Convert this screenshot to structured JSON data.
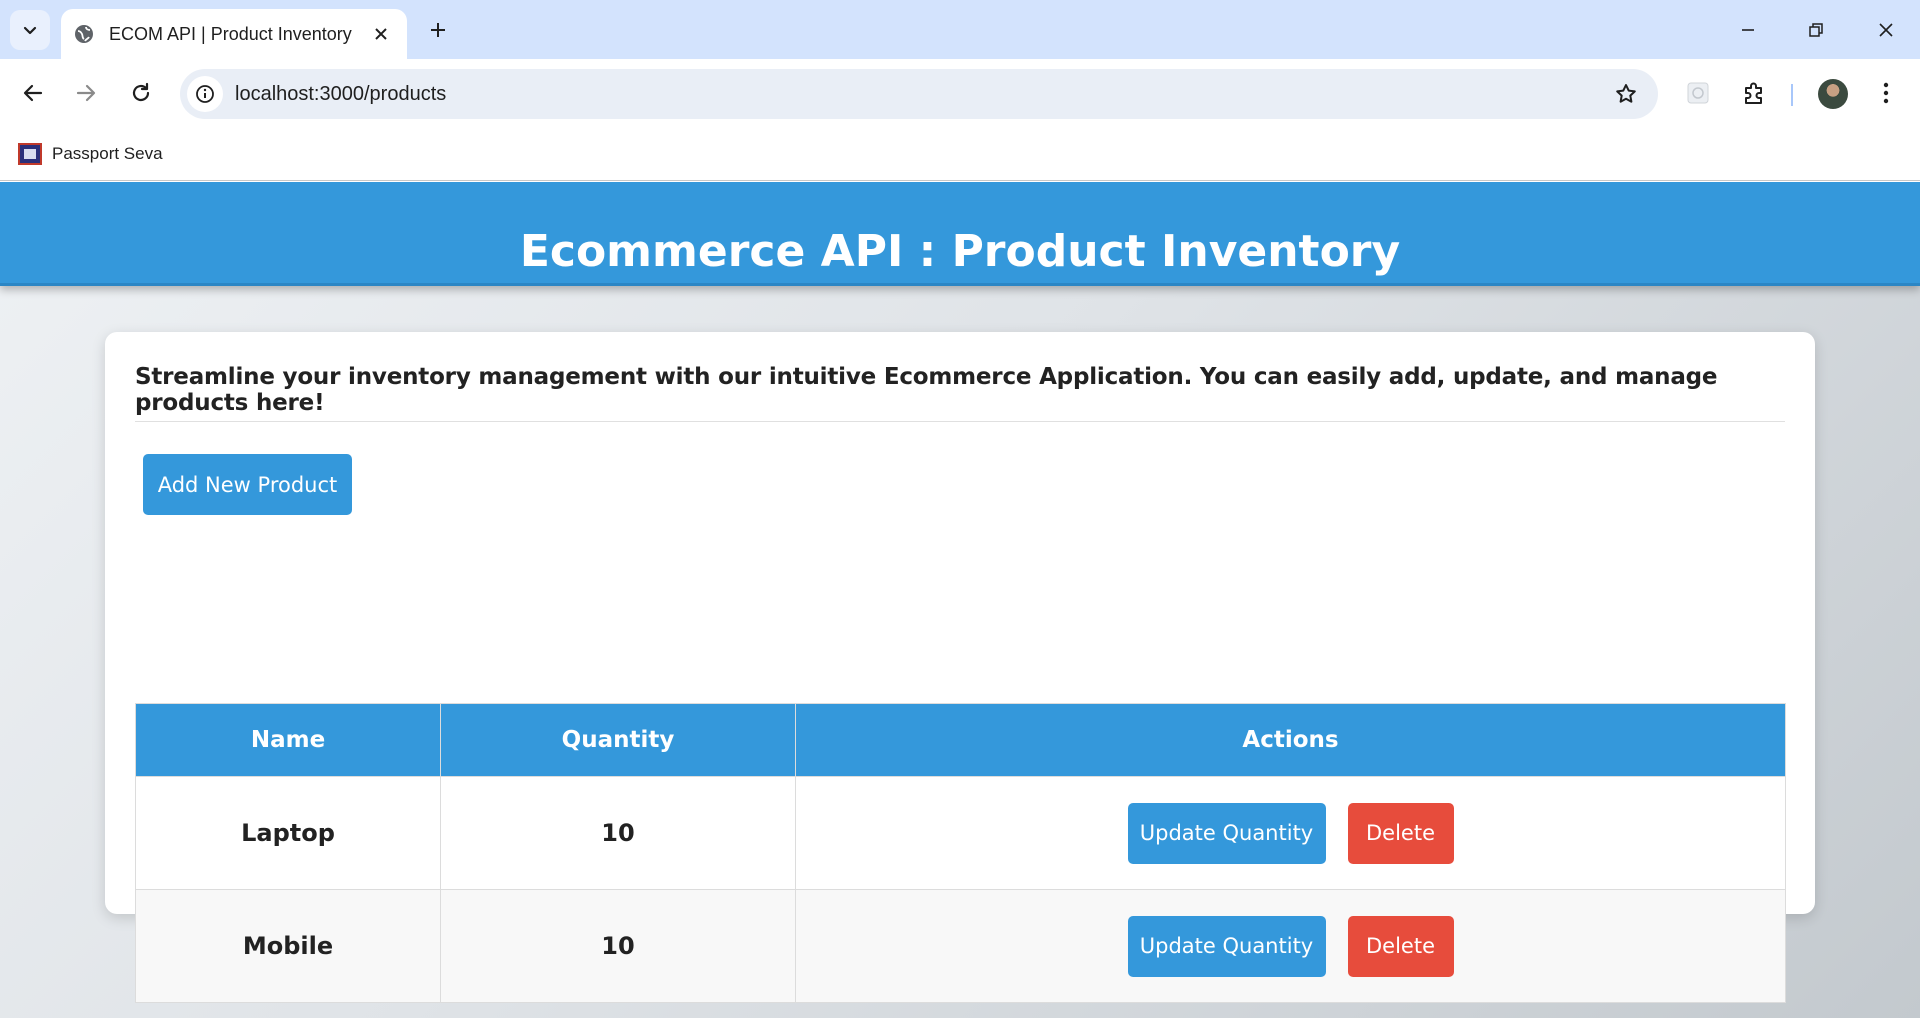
{
  "browser": {
    "tab_title": "ECOM API | Product Inventory",
    "url": "localhost:3000/products",
    "bookmarks": [
      {
        "label": "Passport Seva"
      }
    ]
  },
  "app": {
    "header_title": "Ecommerce API : Product Inventory",
    "intro_text": "Streamline your inventory management with our intuitive Ecommerce Application. You can easily add, update, and manage products here!",
    "add_button_label": "Add New Product",
    "table": {
      "headers": [
        "Name",
        "Quantity",
        "Actions"
      ],
      "rows": [
        {
          "name": "Laptop",
          "quantity": "10",
          "update_label": "Update Quantity",
          "delete_label": "Delete"
        },
        {
          "name": "Mobile",
          "quantity": "10",
          "update_label": "Update Quantity",
          "delete_label": "Delete"
        }
      ]
    }
  },
  "colors": {
    "primary": "#3498db",
    "danger": "#e74c3c",
    "tabstrip": "#d3e3fd"
  }
}
